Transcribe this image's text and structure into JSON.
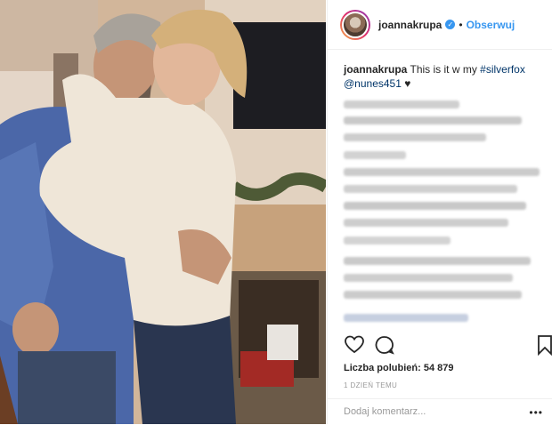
{
  "post": {
    "photo_label": "post-photo",
    "username": "joannakrupa",
    "verified_icon": "verified-badge-icon",
    "separator": "•",
    "follow_label": "Obserwuj"
  },
  "caption": {
    "username": "joannakrupa",
    "text": "This is it w my ",
    "hashtag": "#silverfox",
    "mention": "@nunes451",
    "heart": "♥"
  },
  "actions": {
    "like_icon": "heart-icon",
    "comment_icon": "comment-icon",
    "save_icon": "bookmark-icon"
  },
  "likes": {
    "label": "Liczba polubień:",
    "count": "54 879"
  },
  "time_ago": "1 DZIEŃ TEMU",
  "comment": {
    "placeholder": "Dodaj komentarz...",
    "more_label": "•••"
  },
  "colors": {
    "accent": "#3897f0",
    "text": "#262626",
    "muted": "#999999",
    "border": "#efefef"
  }
}
